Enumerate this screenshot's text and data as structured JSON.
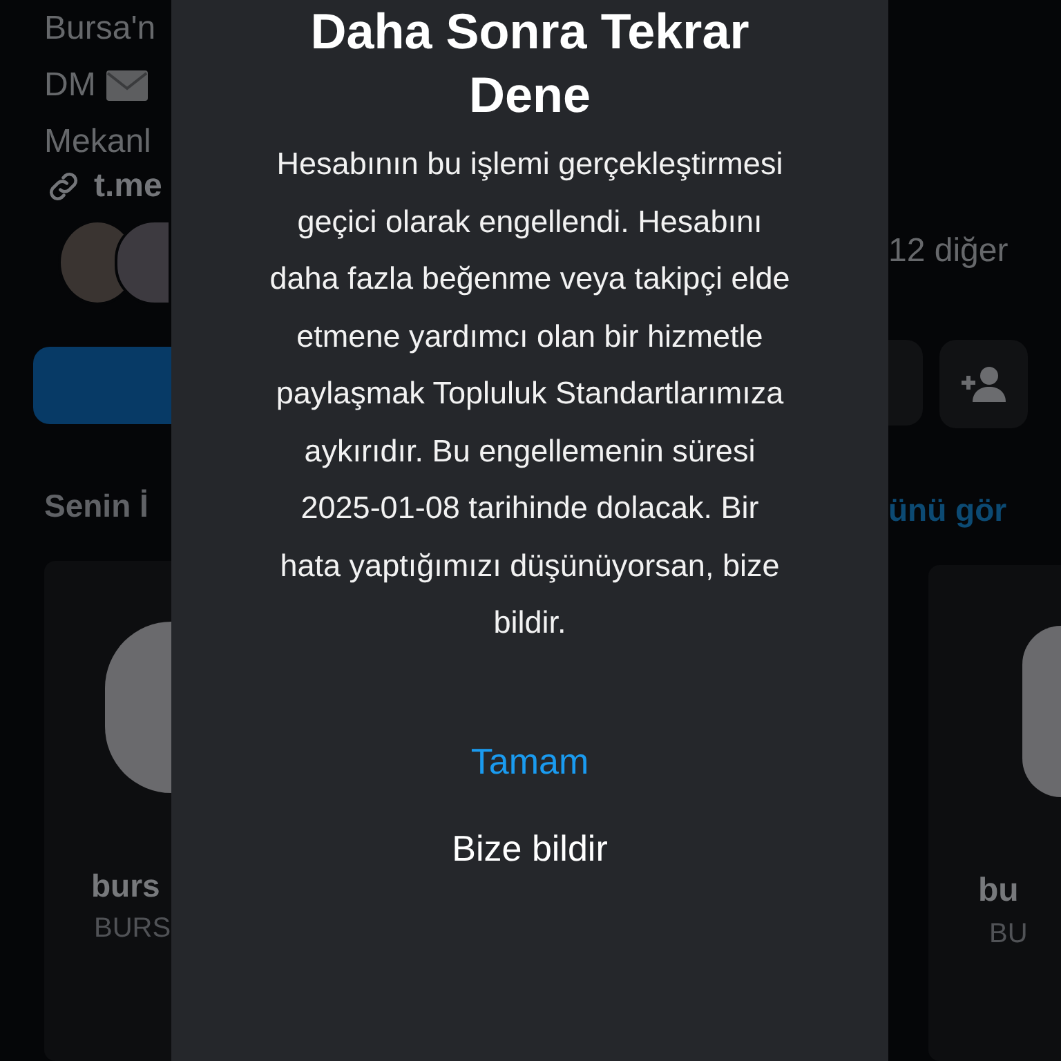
{
  "profile": {
    "bio_lines": [
      "Bursa'n",
      "DM",
      "Mekanl"
    ],
    "link": "t.me",
    "followers_text": "12 diğer"
  },
  "suggestions": {
    "title": "Senin İ",
    "see_all": "ünü gör",
    "cards": [
      {
        "name": "burs",
        "subtitle": "BURS"
      },
      {
        "name": "bu",
        "subtitle": "BU"
      }
    ]
  },
  "dialog": {
    "title": "Daha Sonra Tekrar Dene",
    "message": "Hesabının bu işlemi gerçekleştirmesi geçici olarak engellendi. Hesabını daha fazla beğenme veya takipçi elde etmene yardımcı olan bir hizmetle paylaşmak Topluluk Standartlarımıza aykırıdır. Bu engellemenin süresi 2025-01-08 tarihinde dolacak. Bir hata yaptığımızı düşünüyorsan, bize bildir.",
    "buttons": [
      {
        "label": "Tamam",
        "kind": "primary"
      },
      {
        "label": "Bize bildir",
        "kind": "plain"
      }
    ]
  }
}
